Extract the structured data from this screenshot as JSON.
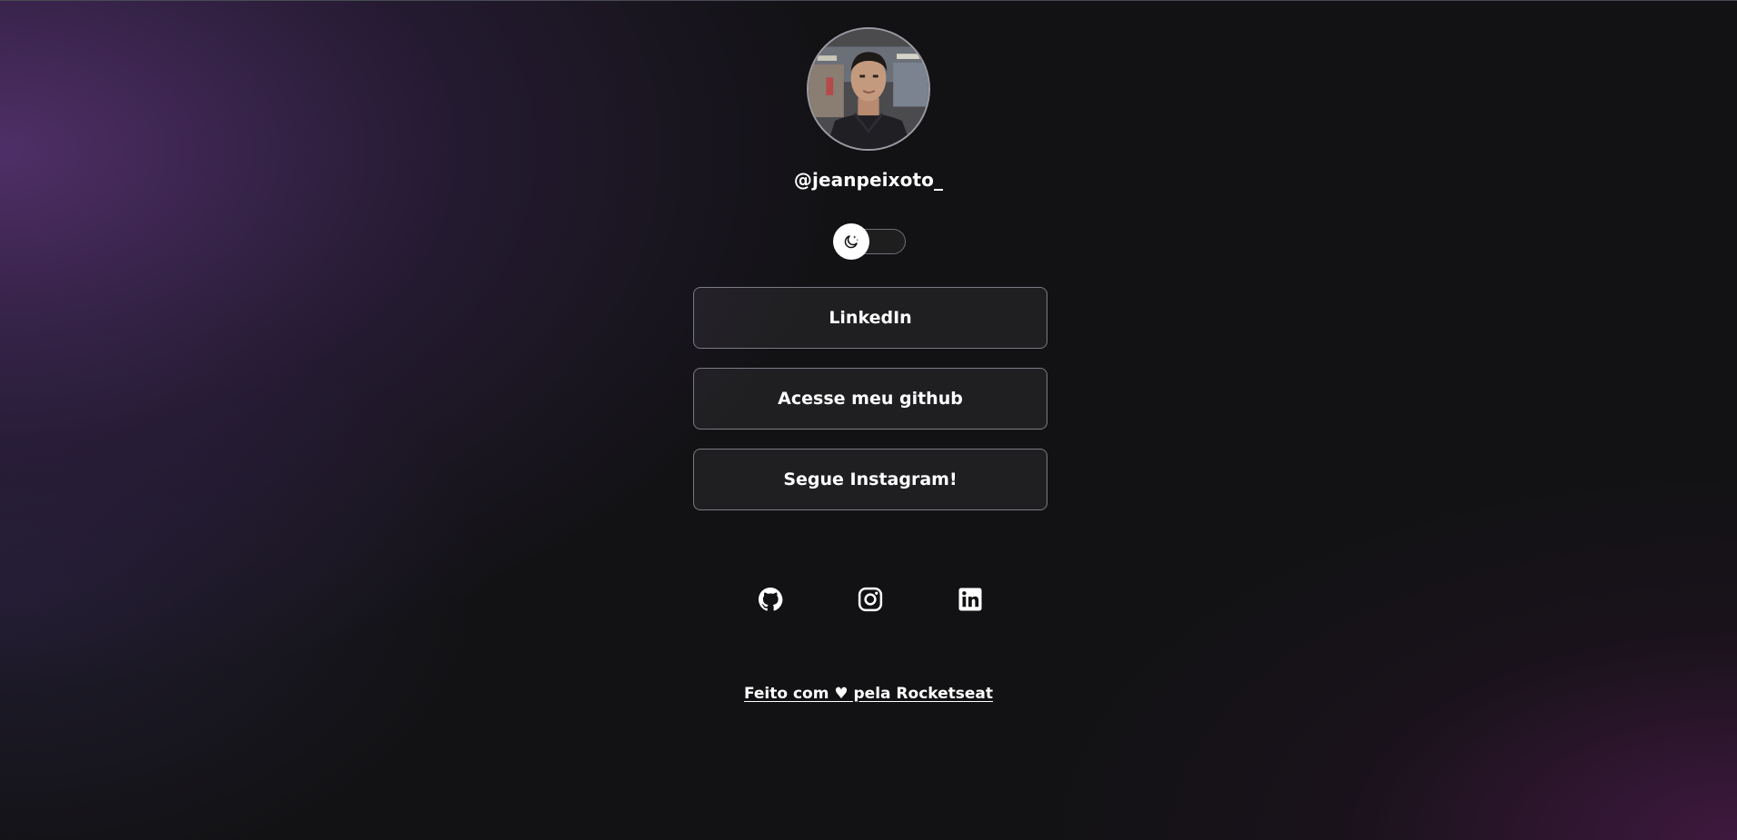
{
  "profile": {
    "username": "@jeanpeixoto_",
    "avatar_icon": "profile-photo"
  },
  "theme_switch": {
    "icon": "moon-icon",
    "state": "dark"
  },
  "links": [
    {
      "label": "LinkedIn"
    },
    {
      "label": "Acesse meu github"
    },
    {
      "label": "Segue Instagram!"
    }
  ],
  "social": [
    {
      "icon": "github-icon"
    },
    {
      "icon": "instagram-icon"
    },
    {
      "icon": "linkedin-icon"
    }
  ],
  "footer": {
    "text": "Feito com ♥ pela Rocketseat"
  },
  "colors": {
    "background": "#121214",
    "accent_purple": "#5a3476",
    "accent_magenta": "#4a1a4a",
    "button_border": "#7a7a84",
    "text": "#ffffff"
  }
}
